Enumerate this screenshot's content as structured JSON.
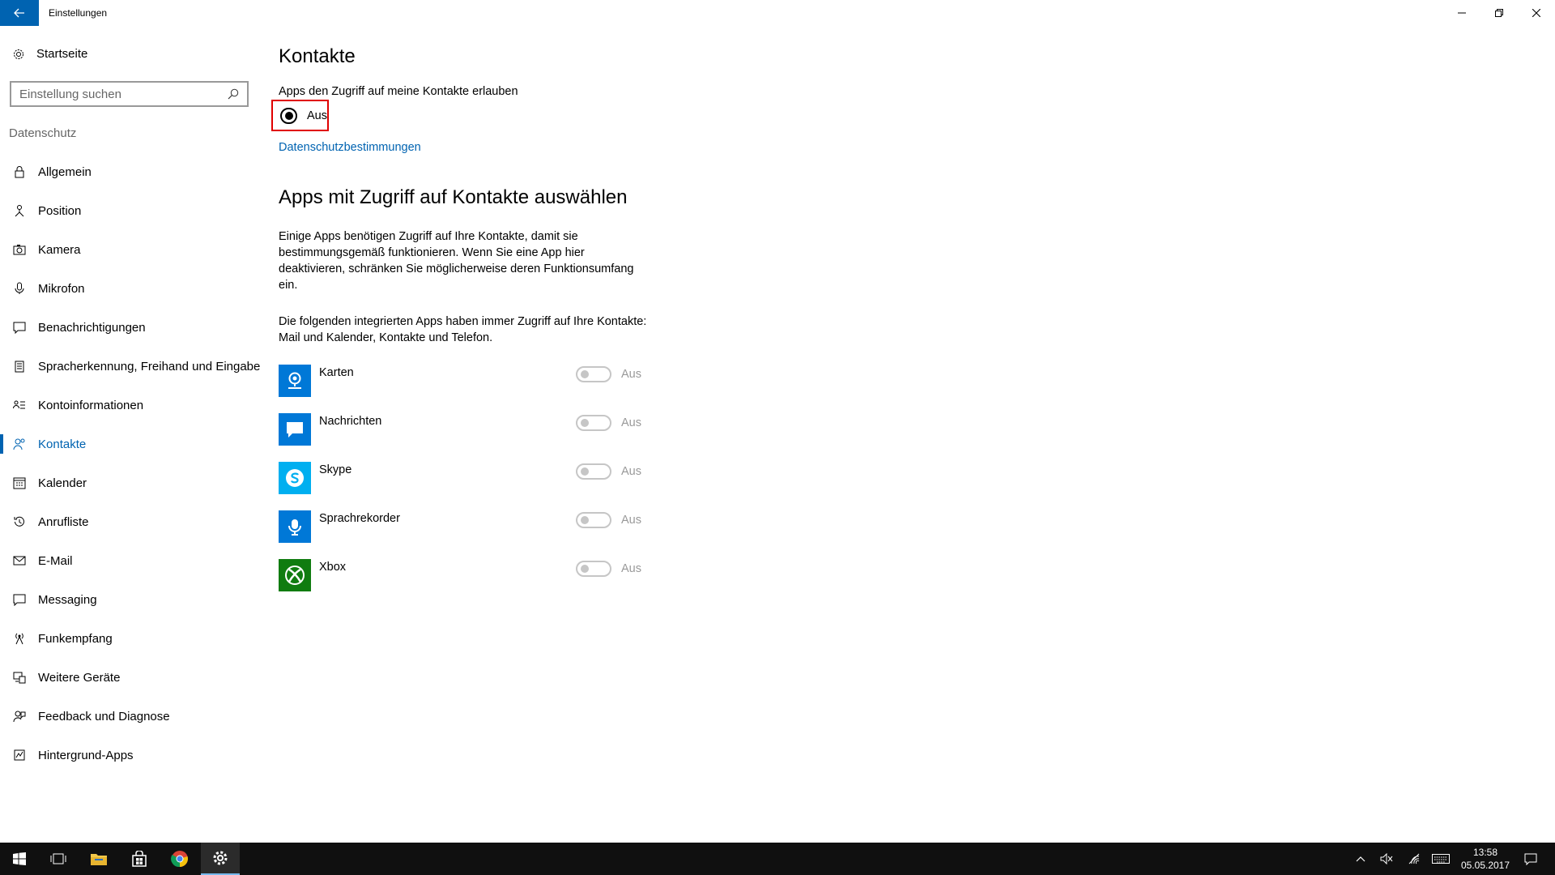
{
  "window": {
    "title": "Einstellungen"
  },
  "sidebar": {
    "home_label": "Startseite",
    "search_placeholder": "Einstellung suchen",
    "section_label": "Datenschutz",
    "items": [
      {
        "label": "Allgemein",
        "icon": "lock-icon"
      },
      {
        "label": "Position",
        "icon": "location-icon"
      },
      {
        "label": "Kamera",
        "icon": "camera-icon"
      },
      {
        "label": "Mikrofon",
        "icon": "microphone-icon"
      },
      {
        "label": "Benachrichtigungen",
        "icon": "notification-icon"
      },
      {
        "label": "Spracherkennung, Freihand und Eingabe",
        "icon": "speech-icon"
      },
      {
        "label": "Kontoinformationen",
        "icon": "account-info-icon"
      },
      {
        "label": "Kontakte",
        "icon": "contacts-icon",
        "active": true
      },
      {
        "label": "Kalender",
        "icon": "calendar-icon"
      },
      {
        "label": "Anrufliste",
        "icon": "history-icon"
      },
      {
        "label": "E-Mail",
        "icon": "mail-icon"
      },
      {
        "label": "Messaging",
        "icon": "message-icon"
      },
      {
        "label": "Funkempfang",
        "icon": "radio-icon"
      },
      {
        "label": "Weitere Geräte",
        "icon": "devices-icon"
      },
      {
        "label": "Feedback und Diagnose",
        "icon": "feedback-icon"
      },
      {
        "label": "Hintergrund-Apps",
        "icon": "background-apps-icon"
      }
    ]
  },
  "main": {
    "title": "Kontakte",
    "allow_label": "Apps den Zugriff auf meine Kontakte erlauben",
    "allow_state": "Aus",
    "privacy_link": "Datenschutzbestimmungen",
    "section_title": "Apps mit Zugriff auf Kontakte auswählen",
    "para1": "Einige Apps benötigen Zugriff auf Ihre Kontakte, damit sie bestimmungsgemäß funktionieren. Wenn Sie eine App hier deaktivieren, schränken Sie möglicherweise deren Funktionsumfang ein.",
    "para2": "Die folgenden integrierten Apps haben immer Zugriff auf Ihre Kontakte: Mail und Kalender, Kontakte und Telefon.",
    "apps": [
      {
        "name": "Karten",
        "state": "Aus",
        "icon": "maps-icon",
        "color": "#0078d7"
      },
      {
        "name": "Nachrichten",
        "state": "Aus",
        "icon": "messaging-app-icon",
        "color": "#0078d7"
      },
      {
        "name": "Skype",
        "state": "Aus",
        "icon": "skype-icon",
        "color": "#00aff0"
      },
      {
        "name": "Sprachrekorder",
        "state": "Aus",
        "icon": "voice-recorder-icon",
        "color": "#0078d7"
      },
      {
        "name": "Xbox",
        "state": "Aus",
        "icon": "xbox-icon",
        "color": "#107c10"
      }
    ]
  },
  "taskbar": {
    "time": "13:58",
    "date": "05.05.2017"
  },
  "colors": {
    "accent": "#0063b1",
    "highlight_border": "#e00000",
    "taskbar": "#101010"
  }
}
